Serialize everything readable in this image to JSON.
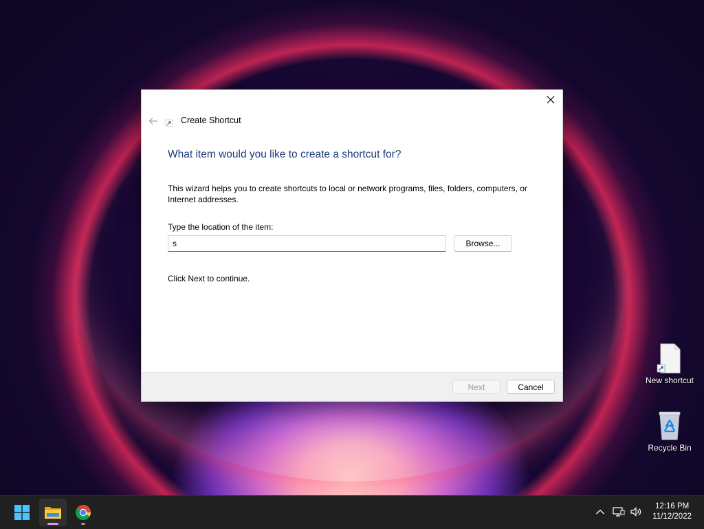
{
  "dialog": {
    "title": "Create Shortcut",
    "heading": "What item would you like to create a shortcut for?",
    "description": "This wizard helps you to create shortcuts to local or network programs, files, folders, computers, or Internet addresses.",
    "location_label": "Type the location of the item:",
    "location_value": "s",
    "browse_label": "Browse...",
    "hint": "Click Next to continue.",
    "next_label": "Next",
    "cancel_label": "Cancel",
    "next_enabled": false
  },
  "desktop": {
    "icons": [
      {
        "label": "New shortcut",
        "icon": "shortcut-file-icon"
      },
      {
        "label": "Recycle Bin",
        "icon": "recycle-bin-icon"
      }
    ]
  },
  "taskbar": {
    "apps": [
      {
        "name": "Start",
        "icon": "windows-start-icon"
      },
      {
        "name": "File Explorer",
        "icon": "file-explorer-icon",
        "active": true
      },
      {
        "name": "Google Chrome",
        "icon": "chrome-icon"
      }
    ],
    "clock": {
      "time": "12:16 PM",
      "date": "11/12/2022"
    }
  },
  "colors": {
    "heading": "#1c3c7a",
    "taskbar": "#202020",
    "accent": "#0078d4"
  }
}
